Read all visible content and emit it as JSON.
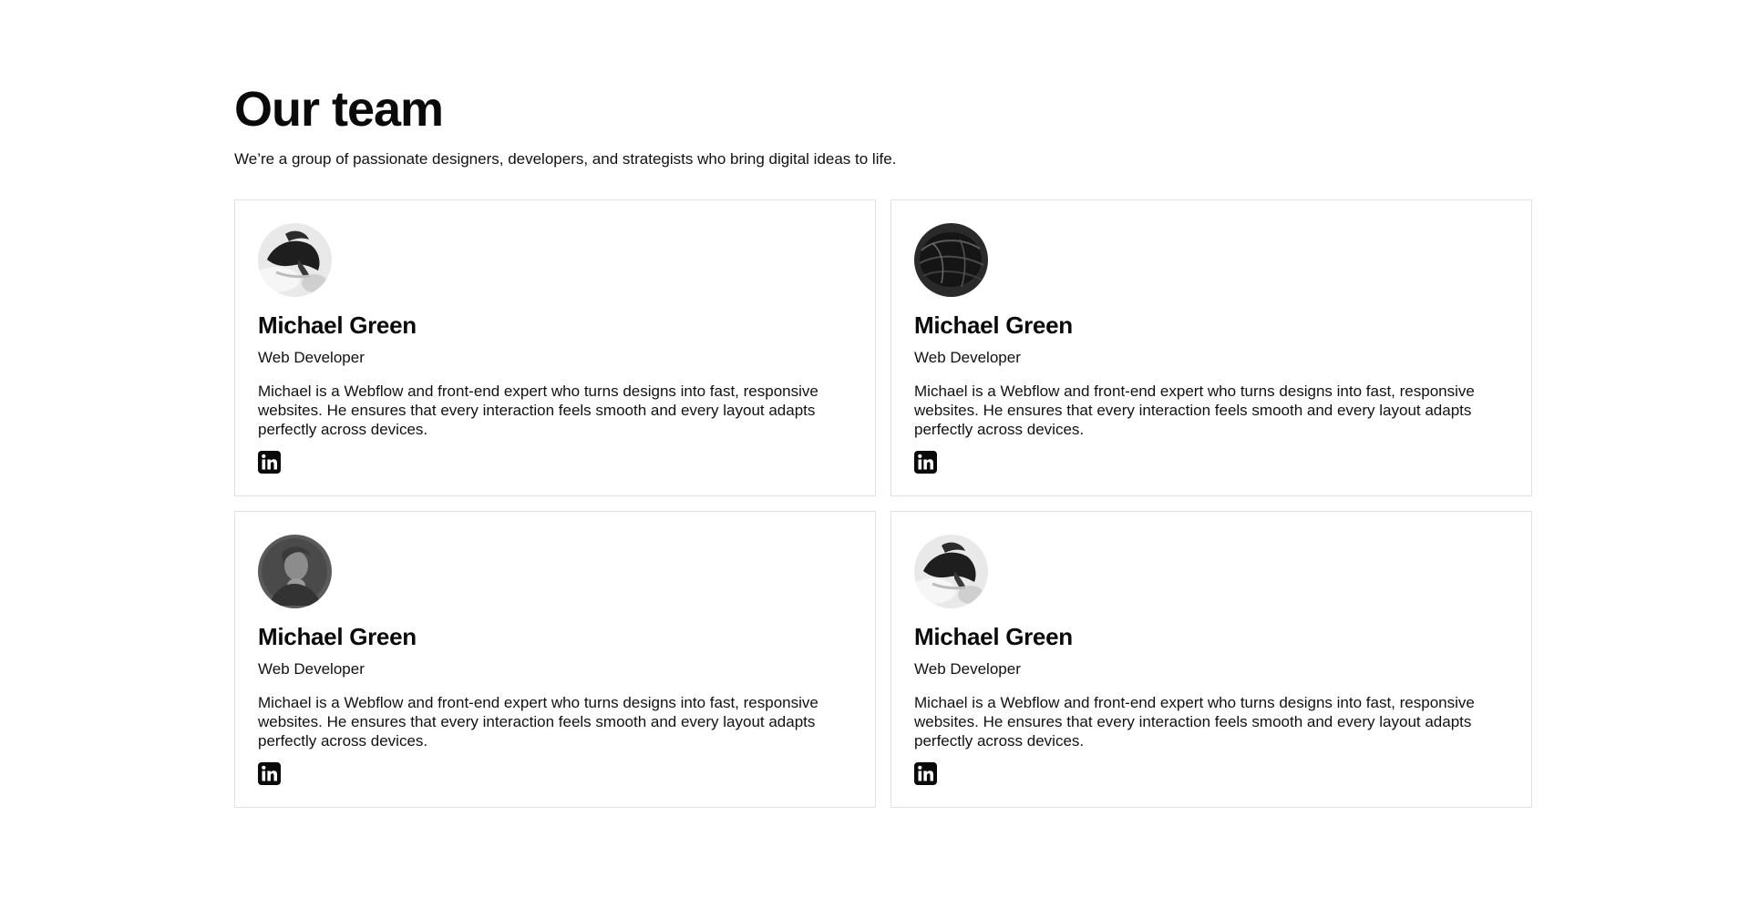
{
  "header": {
    "title": "Our team",
    "subtitle": "We’re a group of passionate designers, developers, and strategists who bring digital ideas to life."
  },
  "team": [
    {
      "name": "Michael Green",
      "role": "Web Developer",
      "bio": "Michael is a Webflow and front-end expert who turns designs into fast, responsive websites. He ensures that every interaction feels smooth and every layout adapts perfectly across devices.",
      "social_icon": "linkedin-icon"
    },
    {
      "name": "Michael Green",
      "role": "Web Developer",
      "bio": "Michael is a Webflow and front-end expert who turns designs into fast, responsive websites. He ensures that every interaction feels smooth and every layout adapts perfectly across devices.",
      "social_icon": "linkedin-icon"
    },
    {
      "name": "Michael Green",
      "role": "Web Developer",
      "bio": "Michael is a Webflow and front-end expert who turns designs into fast, responsive websites. He ensures that every interaction feels smooth and every layout adapts perfectly across devices.",
      "social_icon": "linkedin-icon"
    },
    {
      "name": "Michael Green",
      "role": "Web Developer",
      "bio": "Michael is a Webflow and front-end expert who turns designs into fast, responsive websites. He ensures that every interaction feels smooth and every layout adapts perfectly across devices.",
      "social_icon": "linkedin-icon"
    }
  ],
  "colors": {
    "text": "#111111",
    "card_border": "#e1e1e1",
    "background": "#ffffff"
  }
}
